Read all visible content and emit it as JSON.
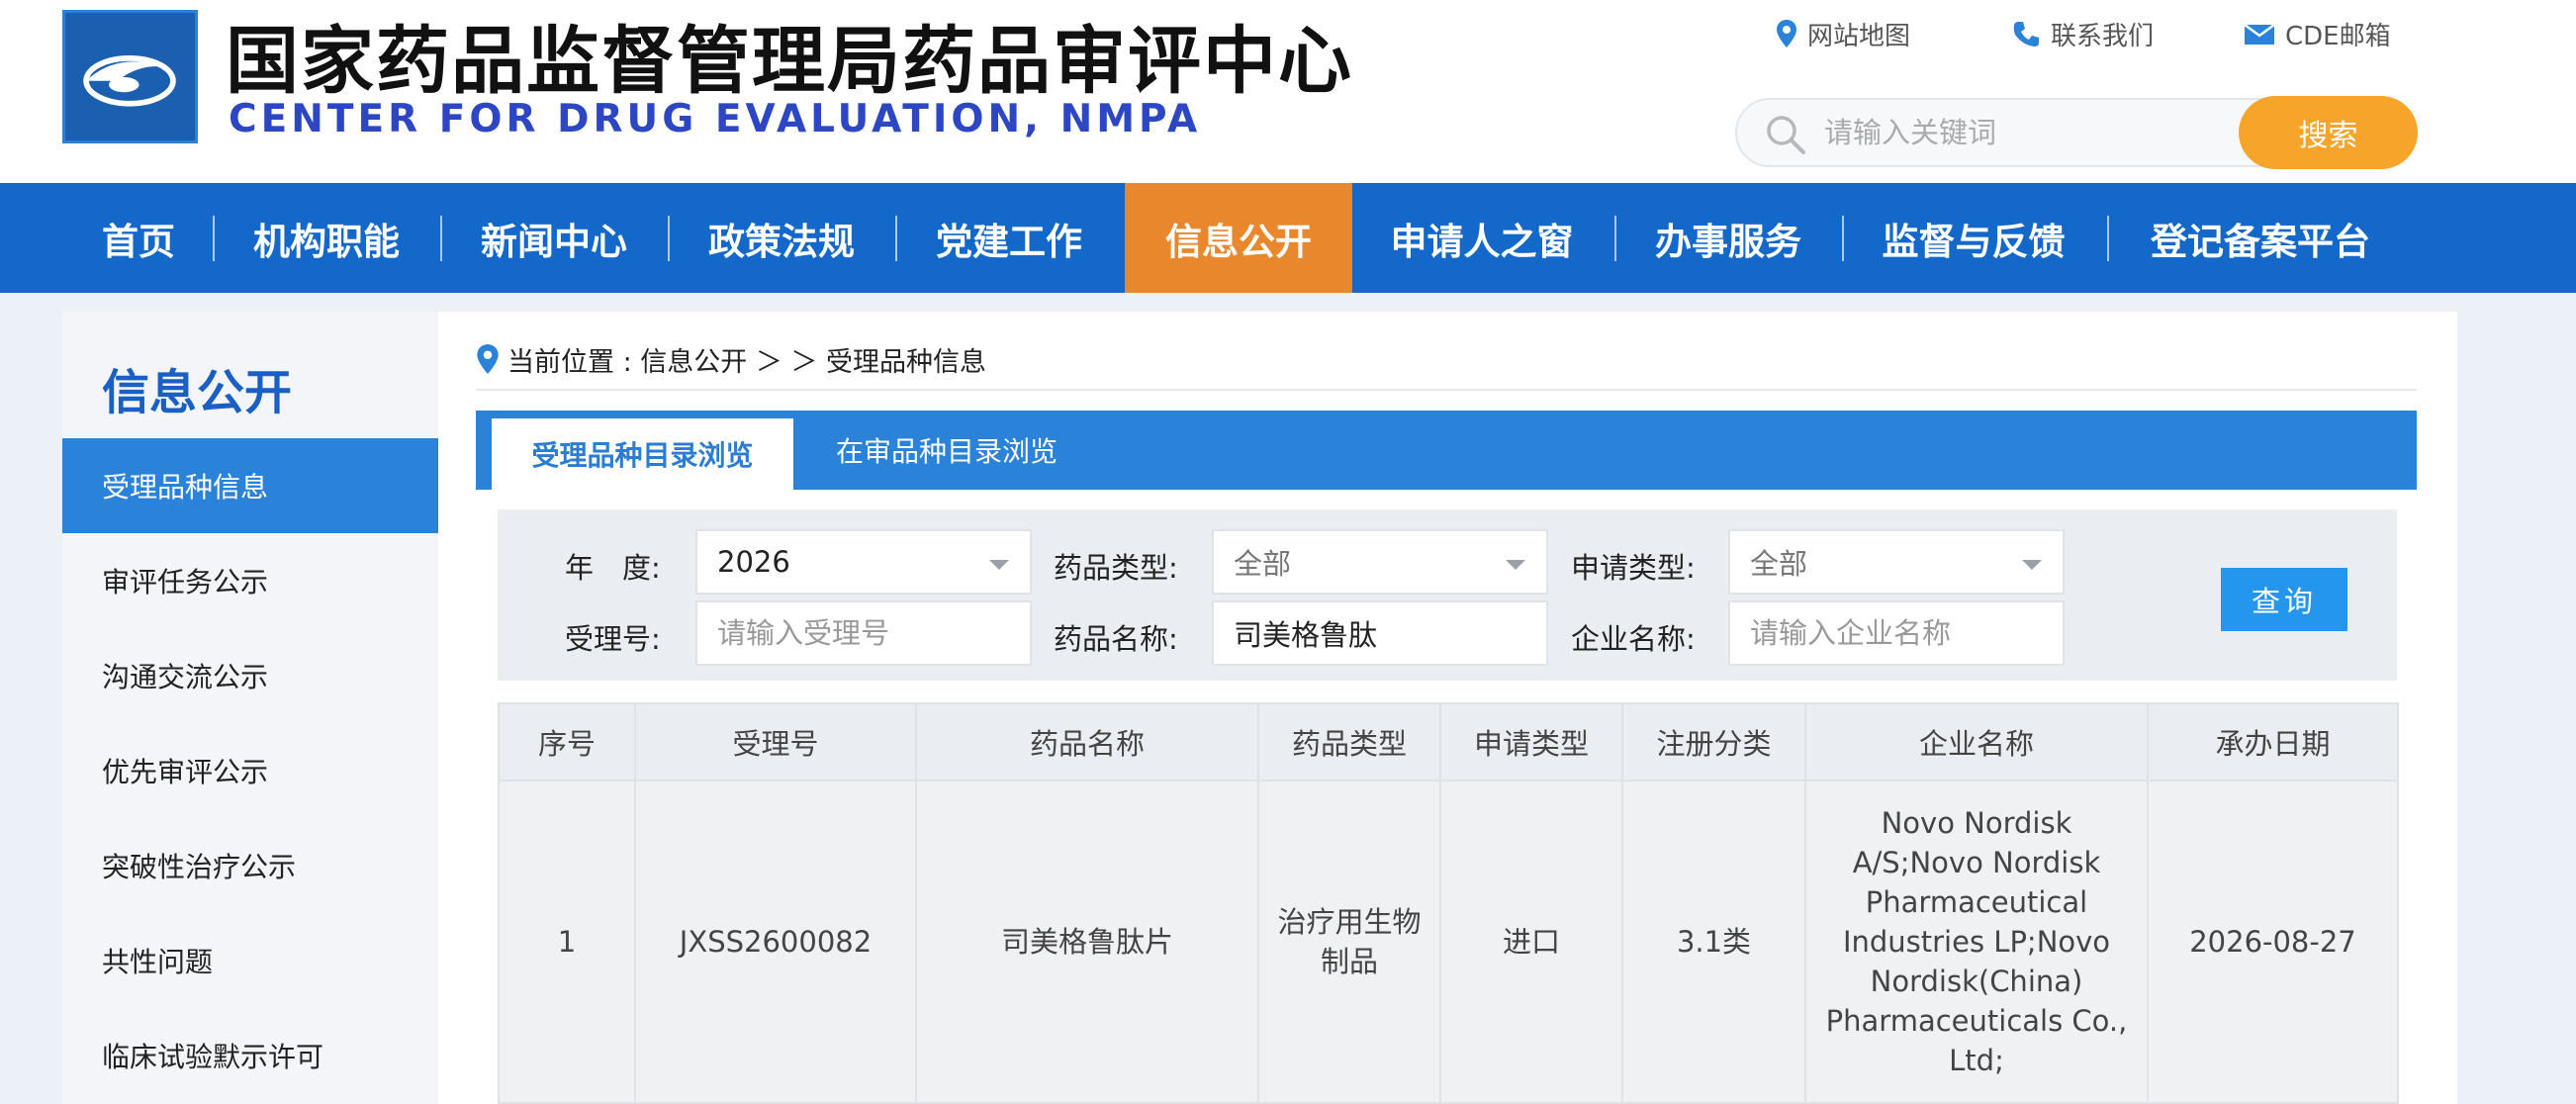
{
  "header": {
    "title": "国家药品监督管理局药品审评中心",
    "subtitle": "CENTER FOR DRUG EVALUATION, NMPA",
    "links": {
      "sitemap": "网站地图",
      "contact": "联系我们",
      "mail": "CDE邮箱"
    },
    "search": {
      "placeholder": "请输入关键词",
      "button": "搜索"
    }
  },
  "nav": {
    "items": [
      "首页",
      "机构职能",
      "新闻中心",
      "政策法规",
      "党建工作",
      "信息公开",
      "申请人之窗",
      "办事服务",
      "监督与反馈",
      "登记备案平台"
    ],
    "active": "信息公开"
  },
  "sidebar": {
    "title": "信息公开",
    "items": [
      "受理品种信息",
      "审评任务公示",
      "沟通交流公示",
      "优先审评公示",
      "突破性治疗公示",
      "共性问题",
      "临床试验默示许可"
    ],
    "active": "受理品种信息"
  },
  "breadcrumb": {
    "text": "当前位置 : 信息公开 ＞ ＞ 受理品种信息"
  },
  "tabs": {
    "active": "受理品种目录浏览",
    "inactive": "在审品种目录浏览"
  },
  "filter": {
    "year_label": "年　度:",
    "year_value": "2026",
    "drug_type_label": "药品类型:",
    "drug_type_value": "全部",
    "apply_type_label": "申请类型:",
    "apply_type_value": "全部",
    "accept_no_label": "受理号:",
    "accept_no_placeholder": "请输入受理号",
    "drug_name_label": "药品名称:",
    "drug_name_value": "司美格鲁肽",
    "company_label": "企业名称:",
    "company_placeholder": "请输入企业名称",
    "query_button": "查询"
  },
  "table": {
    "headers": [
      "序号",
      "受理号",
      "药品名称",
      "药品类型",
      "申请类型",
      "注册分类",
      "企业名称",
      "承办日期"
    ],
    "rows": [
      {
        "no": "1",
        "accept_no": "JXSS2600082",
        "drug_name": "司美格鲁肽片",
        "drug_type": "治疗用生物制品",
        "apply_type": "进口",
        "reg_class": "3.1类",
        "company": "Novo Nordisk A/S;Novo Nordisk Pharmaceutical Industries LP;Novo Nordisk(China) Pharmaceuticals Co., Ltd;",
        "date": "2026-08-27"
      }
    ]
  },
  "colors": {
    "nav_blue": "#1468c9",
    "nav_active": "#e8872b",
    "tab_blue": "#2b82d9",
    "search_button": "#f6a52a",
    "query_button": "#2596ee",
    "title_blue": "#2d47c4"
  }
}
